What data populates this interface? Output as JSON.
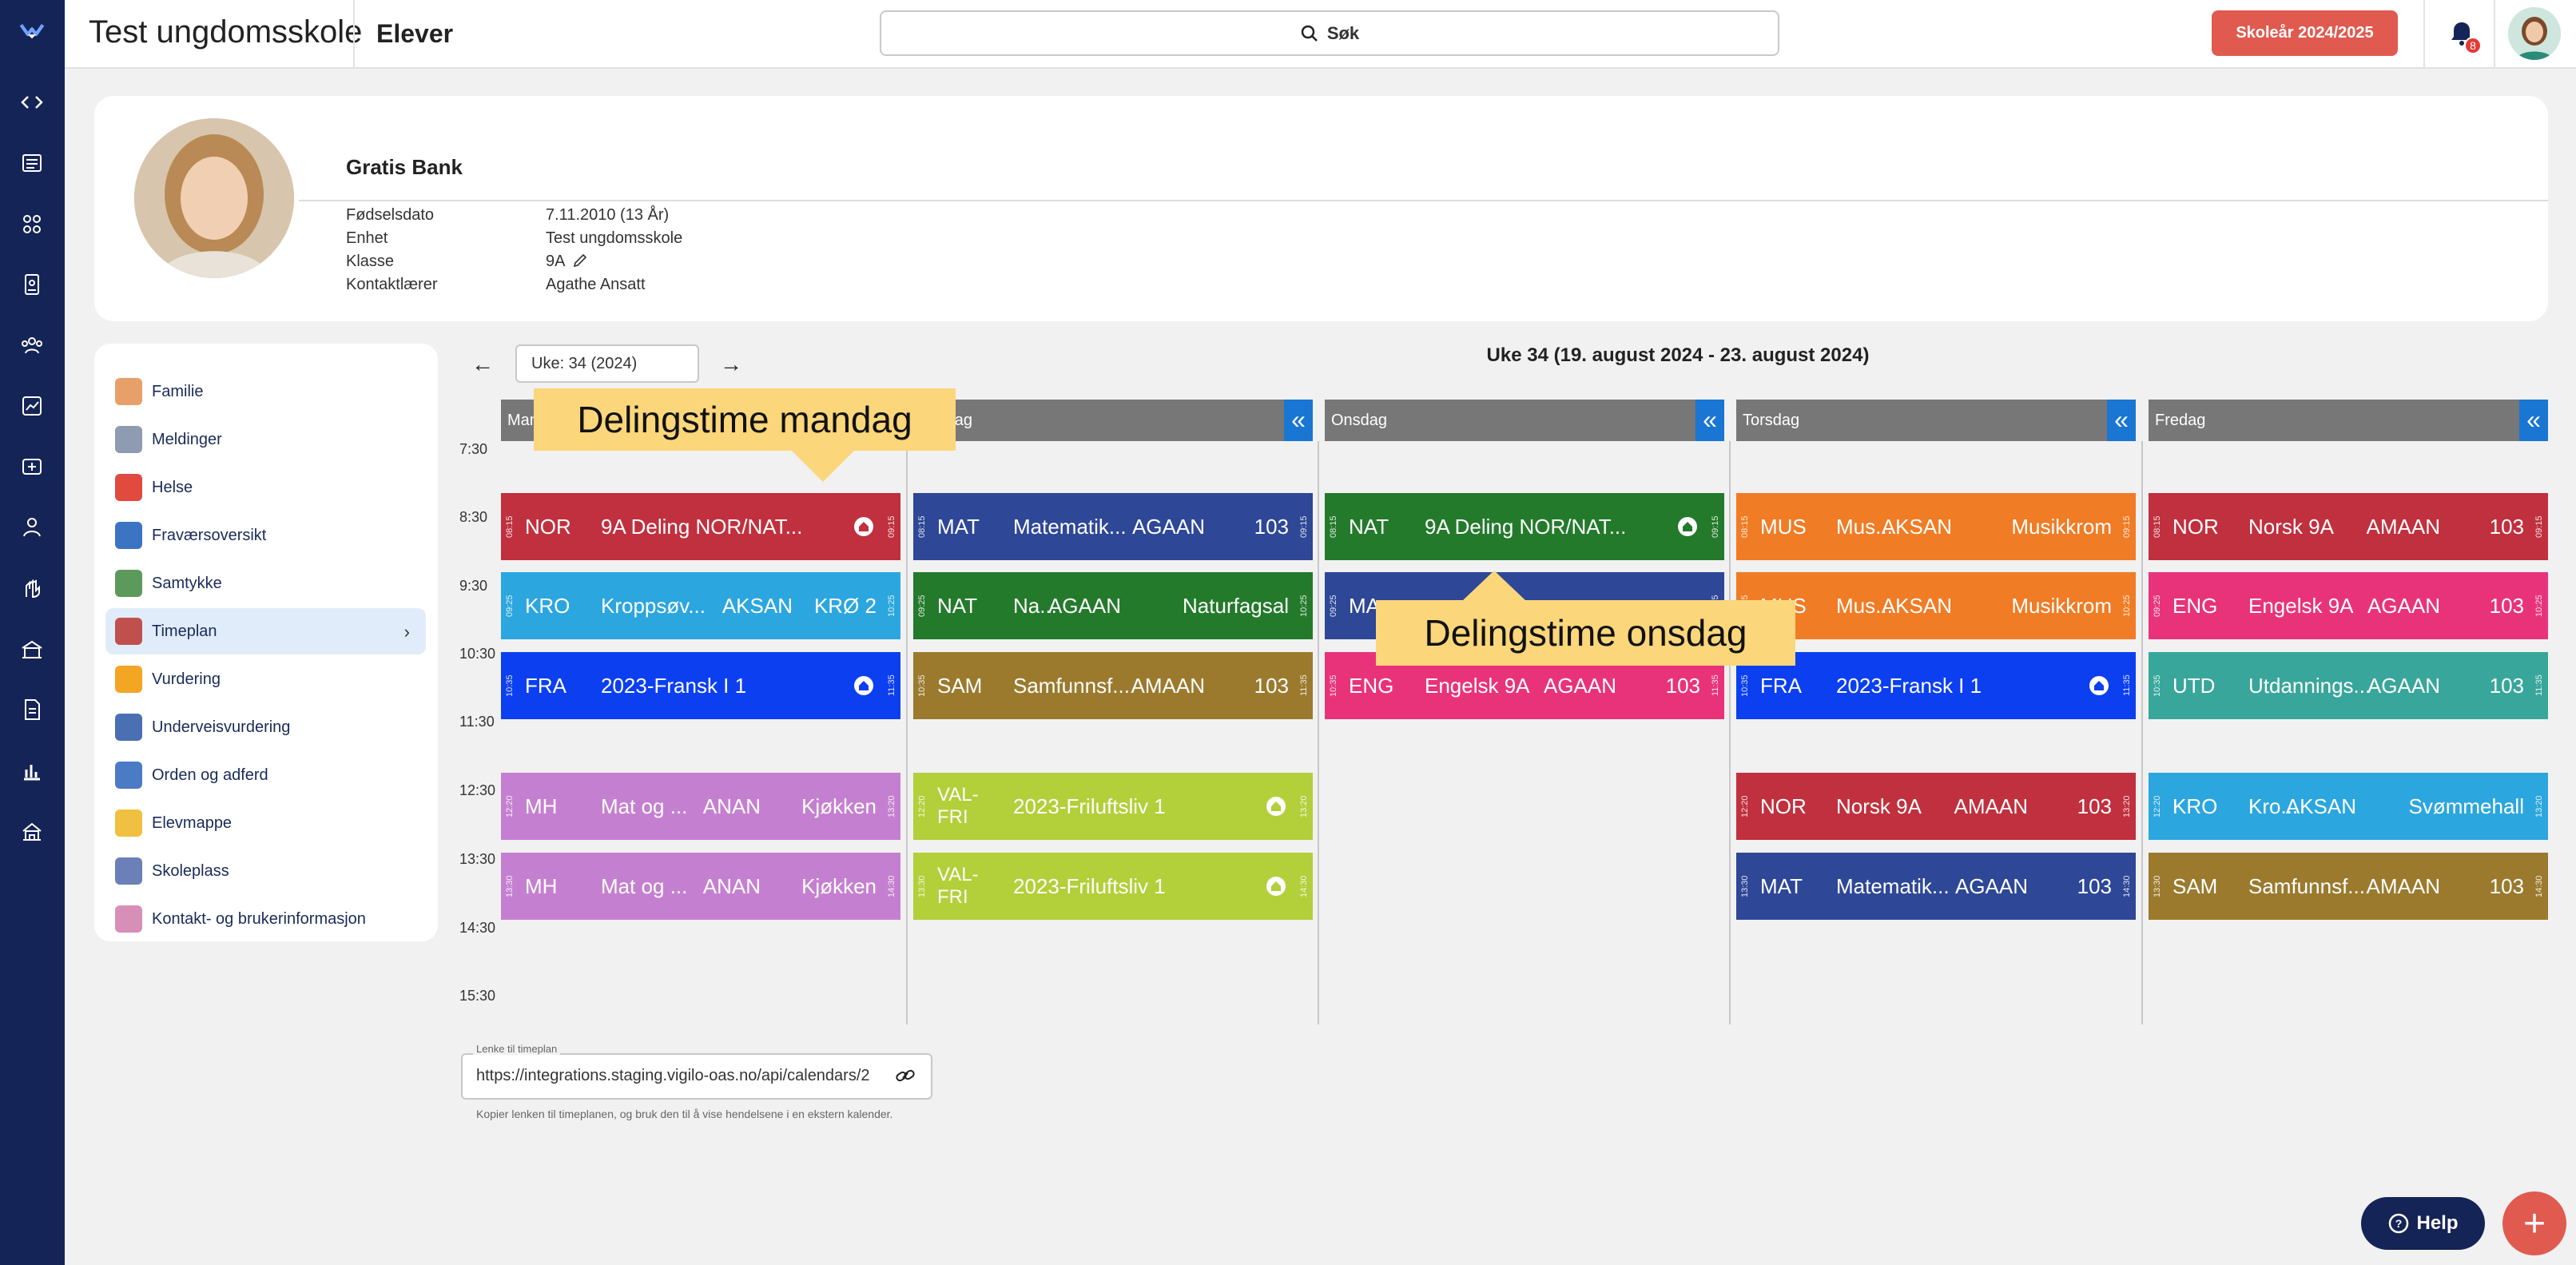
{
  "topbar": {
    "app_title": "Test ungdomsskole",
    "page_title": "Elever",
    "search_label": "Søk",
    "school_year_button": "Skoleår 2024/2025",
    "notification_count": "8"
  },
  "profile": {
    "name": "Gratis Bank",
    "fields": [
      {
        "label": "Fødselsdato",
        "value": "7.11.2010 (13 År)"
      },
      {
        "label": "Enhet",
        "value": "Test ungdomsskole"
      },
      {
        "label": "Klasse",
        "value": "9A"
      },
      {
        "label": "Kontaktlærer",
        "value": "Agathe Ansatt"
      }
    ]
  },
  "menu": {
    "items": [
      {
        "label": "Familie",
        "icon": "family-icon",
        "color": "#e8a06b"
      },
      {
        "label": "Meldinger",
        "icon": "envelope-icon",
        "color": "#8e9bb0"
      },
      {
        "label": "Helse",
        "icon": "health-icon",
        "color": "#e04a3f"
      },
      {
        "label": "Fraværsoversikt",
        "icon": "absence-icon",
        "color": "#3c74c4"
      },
      {
        "label": "Samtykke",
        "icon": "consent-icon",
        "color": "#5c9a5c"
      },
      {
        "label": "Timeplan",
        "icon": "schedule-icon",
        "color": "#c0504d"
      },
      {
        "label": "Vurdering",
        "icon": "award-icon",
        "color": "#f2a623"
      },
      {
        "label": "Underveisvurdering",
        "icon": "assessment-icon",
        "color": "#4a6fb3"
      },
      {
        "label": "Orden og adferd",
        "icon": "conduct-icon",
        "color": "#4b7bc4"
      },
      {
        "label": "Elevmappe",
        "icon": "folder-icon",
        "color": "#f0c040"
      },
      {
        "label": "Skoleplass",
        "icon": "school-place-icon",
        "color": "#6b7fb8"
      },
      {
        "label": "Kontakt- og brukerinformasjon",
        "icon": "contact-info-icon",
        "color": "#d78fb8"
      }
    ],
    "active_index": 5
  },
  "calendar": {
    "week_input": "Uke: 34 (2024)",
    "week_title": "Uke 34 (19. august 2024 - 23. august 2024)",
    "days": [
      "Mandag",
      "Tirsdag",
      "Onsdag",
      "Torsdag",
      "Fredag"
    ],
    "collapse_glyph": "«",
    "times": [
      "7:30",
      "8:30",
      "9:30",
      "10:30",
      "11:30",
      "12:30",
      "13:30",
      "14:30",
      "15:30"
    ],
    "lessons": [
      {
        "day": 0,
        "slot": 0,
        "start": "08:15",
        "end": "09:15",
        "code": "NOR",
        "name": "9A Deling NOR/NAT...",
        "teacher": "",
        "room": "",
        "home": true,
        "color": "#c0303e"
      },
      {
        "day": 0,
        "slot": 1,
        "start": "09:25",
        "end": "10:25",
        "code": "KRO",
        "name": "Kroppsøv...",
        "teacher": "AKSAN",
        "room": "KRØ 2",
        "home": false,
        "color": "#2ba6de"
      },
      {
        "day": 0,
        "slot": 2,
        "start": "10:35",
        "end": "11:35",
        "code": "FRA",
        "name": "2023-Fransk I 1",
        "teacher": "",
        "room": "",
        "home": true,
        "color": "#0b3ff0"
      },
      {
        "day": 0,
        "slot": 3,
        "start": "12:20",
        "end": "13:20",
        "code": "MH",
        "name": "Mat og ...",
        "teacher": "ANAN",
        "room": "Kjøkken",
        "home": false,
        "color": "#c57fd0"
      },
      {
        "day": 0,
        "slot": 4,
        "start": "13:30",
        "end": "14:30",
        "code": "MH",
        "name": "Mat og ...",
        "teacher": "ANAN",
        "room": "Kjøkken",
        "home": false,
        "color": "#c57fd0"
      },
      {
        "day": 1,
        "slot": 0,
        "start": "08:15",
        "end": "09:15",
        "code": "MAT",
        "name": "Matematik...",
        "teacher": "AGAAN",
        "room": "103",
        "home": false,
        "color": "#2e4796"
      },
      {
        "day": 1,
        "slot": 1,
        "start": "09:25",
        "end": "10:25",
        "code": "NAT",
        "name": "Na...",
        "teacher": "AGAAN",
        "room": "Naturfagsal",
        "home": false,
        "color": "#237a2b"
      },
      {
        "day": 1,
        "slot": 2,
        "start": "10:35",
        "end": "11:35",
        "code": "SAM",
        "name": "Samfunnsf...",
        "teacher": "AMAAN",
        "room": "103",
        "home": false,
        "color": "#9b7a2e"
      },
      {
        "day": 1,
        "slot": 3,
        "start": "12:20",
        "end": "13:20",
        "code": "VAL-FRI",
        "name": "2023-Friluftsliv 1",
        "teacher": "",
        "room": "",
        "home": true,
        "color": "#b3cf3a"
      },
      {
        "day": 1,
        "slot": 4,
        "start": "13:30",
        "end": "14:30",
        "code": "VAL-FRI",
        "name": "2023-Friluftsliv 1",
        "teacher": "",
        "room": "",
        "home": true,
        "color": "#b3cf3a"
      },
      {
        "day": 2,
        "slot": 0,
        "start": "08:15",
        "end": "09:15",
        "code": "NAT",
        "name": "9A Deling NOR/NAT...",
        "teacher": "",
        "room": "",
        "home": true,
        "color": "#237a2b"
      },
      {
        "day": 2,
        "slot": 1,
        "start": "09:25",
        "end": "10:25",
        "code": "MA",
        "name": "",
        "teacher": "",
        "room": "",
        "home": false,
        "color": "#2e4796"
      },
      {
        "day": 2,
        "slot": 2,
        "start": "10:35",
        "end": "11:35",
        "code": "ENG",
        "name": "Engelsk 9A",
        "teacher": "AGAAN",
        "room": "103",
        "home": false,
        "color": "#e8337a"
      },
      {
        "day": 3,
        "slot": 0,
        "start": "08:15",
        "end": "09:15",
        "code": "MUS",
        "name": "Mus...",
        "teacher": "AKSAN",
        "room": "Musikkrom",
        "home": false,
        "color": "#f07c25"
      },
      {
        "day": 3,
        "slot": 1,
        "start": "09:25",
        "end": "10:25",
        "code": "MUS",
        "name": "Mus...",
        "teacher": "AKSAN",
        "room": "Musikkrom",
        "home": false,
        "color": "#f07c25"
      },
      {
        "day": 3,
        "slot": 2,
        "start": "10:35",
        "end": "11:35",
        "code": "FRA",
        "name": "2023-Fransk I 1",
        "teacher": "",
        "room": "",
        "home": true,
        "color": "#0b3ff0"
      },
      {
        "day": 3,
        "slot": 3,
        "start": "12:20",
        "end": "13:20",
        "code": "NOR",
        "name": "Norsk 9A",
        "teacher": "AMAAN",
        "room": "103",
        "home": false,
        "color": "#c0303e"
      },
      {
        "day": 3,
        "slot": 4,
        "start": "13:30",
        "end": "14:30",
        "code": "MAT",
        "name": "Matematik...",
        "teacher": "AGAAN",
        "room": "103",
        "home": false,
        "color": "#2e4796"
      },
      {
        "day": 4,
        "slot": 0,
        "start": "08:15",
        "end": "09:15",
        "code": "NOR",
        "name": "Norsk 9A",
        "teacher": "AMAAN",
        "room": "103",
        "home": false,
        "color": "#c0303e"
      },
      {
        "day": 4,
        "slot": 1,
        "start": "09:25",
        "end": "10:25",
        "code": "ENG",
        "name": "Engelsk 9A",
        "teacher": "AGAAN",
        "room": "103",
        "home": false,
        "color": "#e8337a"
      },
      {
        "day": 4,
        "slot": 2,
        "start": "10:35",
        "end": "11:35",
        "code": "UTD",
        "name": "Utdannings...",
        "teacher": "AGAAN",
        "room": "103",
        "home": false,
        "color": "#38a69a"
      },
      {
        "day": 4,
        "slot": 3,
        "start": "12:20",
        "end": "13:20",
        "code": "KRO",
        "name": "Kro...",
        "teacher": "AKSAN",
        "room": "Svømmehall",
        "home": false,
        "color": "#2ba6de"
      },
      {
        "day": 4,
        "slot": 4,
        "start": "13:30",
        "end": "14:30",
        "code": "SAM",
        "name": "Samfunnsf...",
        "teacher": "AMAAN",
        "room": "103",
        "home": false,
        "color": "#9b7a2e"
      }
    ]
  },
  "callouts": {
    "monday": "Delingstime mandag",
    "wednesday": "Delingstime onsdag"
  },
  "link": {
    "legend": "Lenke til timeplan",
    "value": "https://integrations.staging.vigilo-oas.no/api/calendars/2",
    "help": "Kopier lenken til timeplanen, og bruk den til å vise hendelsene i en ekstern kalender."
  },
  "help_button": "Help",
  "fab_glyph": "+"
}
